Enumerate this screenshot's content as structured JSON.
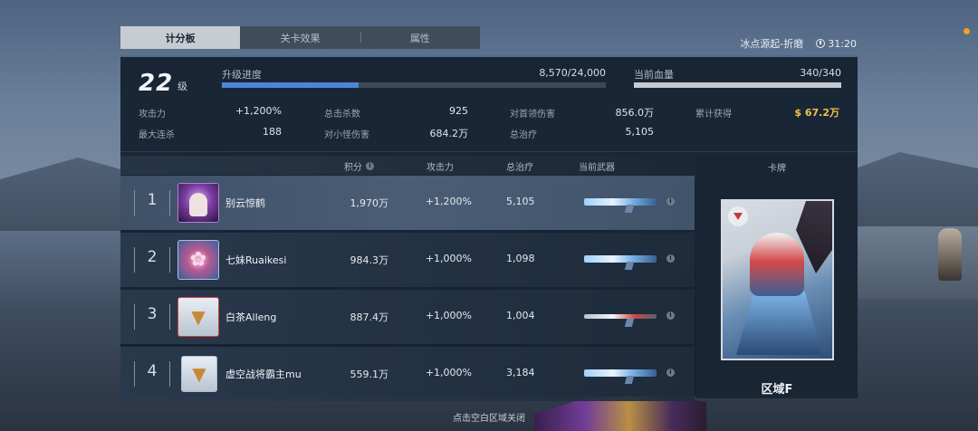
{
  "tabs": [
    {
      "label": "计分板",
      "active": true
    },
    {
      "label": "关卡效果",
      "active": false
    },
    {
      "label": "属性",
      "active": false
    }
  ],
  "top_right": {
    "mode": "冰点源起-折磨",
    "time": "31:20"
  },
  "player": {
    "level": "22",
    "level_unit": "级",
    "xp_label": "升级进度",
    "xp_value": "8,570/24,000",
    "xp_progress": 0.357,
    "hp_label": "当前血量",
    "hp_value": "340/340",
    "hp_progress": 1.0
  },
  "stats": {
    "attack_label": "攻击力",
    "attack_value": "+1,200%",
    "kills_label": "总击杀数",
    "kills_value": "925",
    "boss_dmg_label": "对首领伤害",
    "boss_dmg_value": "856.0万",
    "earned_label": "累计获得",
    "earned_value": "$ 67.2万",
    "combo_label": "最大连杀",
    "combo_value": "188",
    "mob_dmg_label": "对小怪伤害",
    "mob_dmg_value": "684.2万",
    "heal_label": "总治疗",
    "heal_value": "5,105"
  },
  "table": {
    "headers": {
      "score": "积分",
      "attack": "攻击力",
      "heal": "总治疗",
      "weapon": "当前武器",
      "card": "卡牌"
    },
    "rows": [
      {
        "rank": "1",
        "name": "别云惊鹤",
        "score": "1,970万",
        "attack": "+1,200%",
        "heal": "5,105"
      },
      {
        "rank": "2",
        "name": "七妹Ruaikesi",
        "score": "984.3万",
        "attack": "+1,000%",
        "heal": "1,098"
      },
      {
        "rank": "3",
        "name": "白茶Alleng",
        "score": "887.4万",
        "attack": "+1,000%",
        "heal": "1,004"
      },
      {
        "rank": "4",
        "name": "虚空战将霸主mu",
        "score": "559.1万",
        "attack": "+1,000%",
        "heal": "3,184"
      }
    ]
  },
  "card": {
    "name": "区域F"
  },
  "close_hint": "点击空白区域关闭",
  "colors": {
    "accent_blue": "#4b86d8",
    "gold": "#f1c34b",
    "panel_bg": "#131f2d"
  }
}
